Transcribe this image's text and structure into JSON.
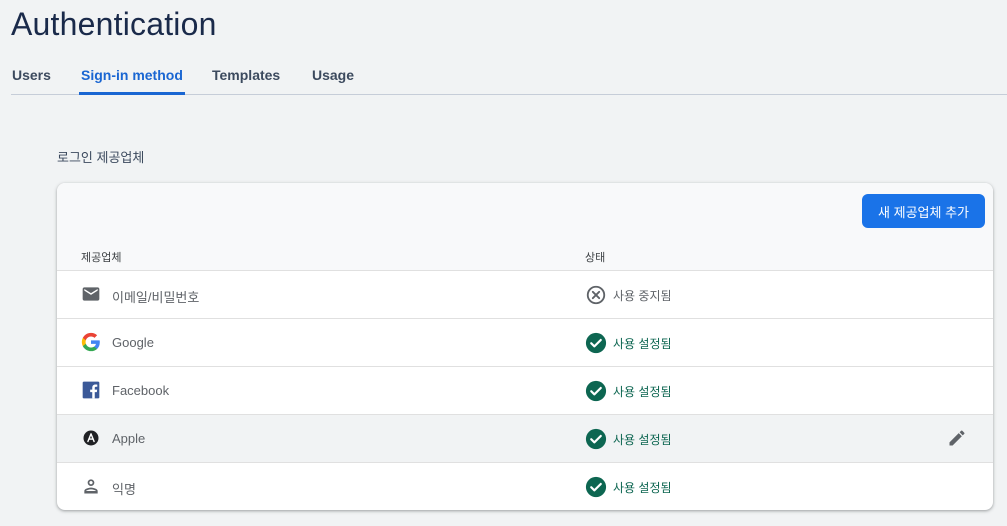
{
  "page": {
    "title": "Authentication"
  },
  "tabs": [
    {
      "label": "Users"
    },
    {
      "label": "Sign-in method"
    },
    {
      "label": "Templates"
    },
    {
      "label": "Usage"
    }
  ],
  "section": {
    "label": "로그인 제공업체"
  },
  "card": {
    "add_button": "새 제공업체 추가",
    "columns": {
      "provider": "제공업체",
      "status": "상태"
    },
    "rows": [
      {
        "icon": "email-icon",
        "name": "이메일/비밀번호",
        "status": "사용 중지됨",
        "enabled": false
      },
      {
        "icon": "google-icon",
        "name": "Google",
        "status": "사용 설정됨",
        "enabled": true
      },
      {
        "icon": "facebook-icon",
        "name": "Facebook",
        "status": "사용 설정됨",
        "enabled": true
      },
      {
        "icon": "apple-icon",
        "name": "Apple",
        "status": "사용 설정됨",
        "enabled": true
      },
      {
        "icon": "person-icon",
        "name": "익명",
        "status": "사용 설정됨",
        "enabled": true
      }
    ]
  },
  "colors": {
    "accent": "#1a73e8",
    "enabled": "#0d6651",
    "disabled": "#5f6368"
  }
}
